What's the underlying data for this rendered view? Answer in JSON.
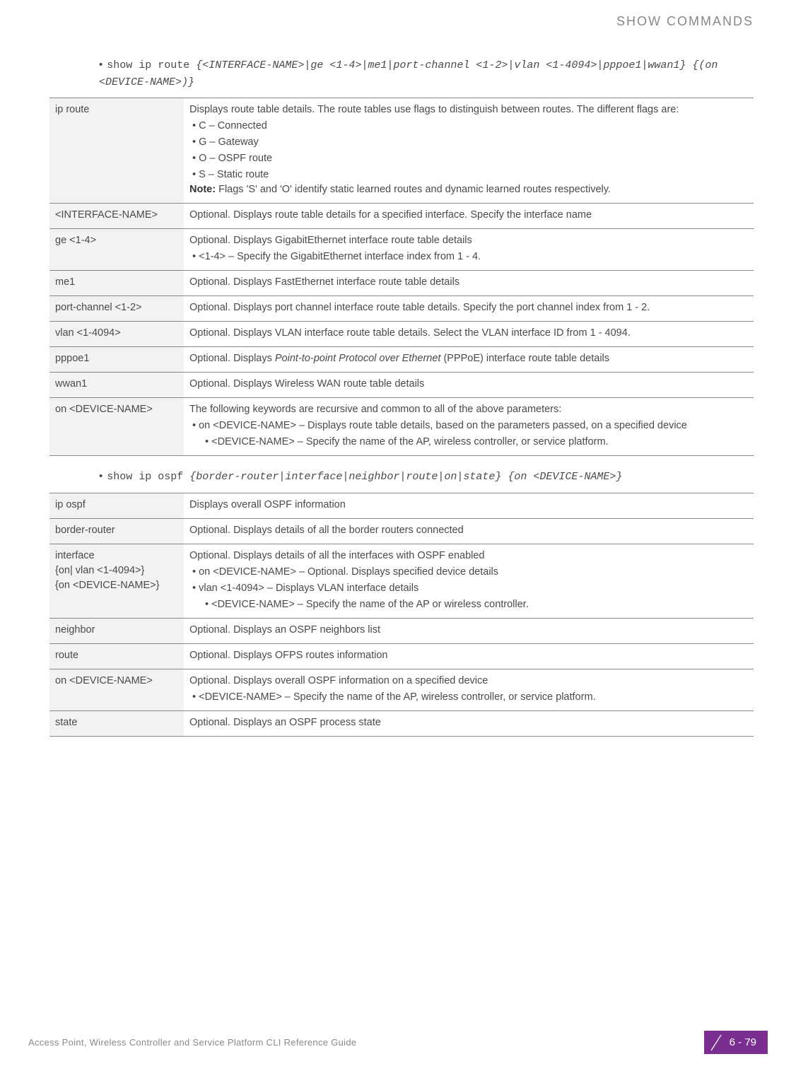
{
  "header": {
    "title": "SHOW COMMANDS"
  },
  "commands": [
    {
      "prefix": "show ip route ",
      "args": "{<INTERFACE-NAME>|ge <1-4>|me1|port-channel <1-2>|vlan <1-4094>|pppoe1|wwan1} {(on <DEVICE-NAME>)}"
    },
    {
      "prefix": "show ip ospf ",
      "args": "{border-router|interface|neighbor|route|on|state} {on <DEVICE-NAME>}"
    }
  ],
  "table1": {
    "r0": {
      "param": "ip route",
      "desc1": "Displays route table details. The route tables use flags to distinguish between routes. The different flags are:",
      "b1": "C – Connected",
      "b2": "G – Gateway",
      "b3": "O – OSPF route",
      "b4": "S – Static route",
      "noteLabel": "Note:",
      "note": " Flags 'S' and 'O' identify static learned routes and dynamic learned routes respectively."
    },
    "r1": {
      "param": "<INTERFACE-NAME>",
      "desc": "Optional. Displays route table details for a specified interface. Specify the interface name"
    },
    "r2": {
      "param": "ge <1-4>",
      "desc": "Optional. Displays GigabitEthernet interface route table details",
      "b1": "<1-4> – Specify the GigabitEthernet interface index from 1 - 4."
    },
    "r3": {
      "param": "me1",
      "desc": "Optional. Displays FastEthernet interface route table details"
    },
    "r4": {
      "param": "port-channel <1-2>",
      "desc": "Optional. Displays port channel interface route table details. Specify the port channel index from 1 - 2."
    },
    "r5": {
      "param": "vlan <1-4094>",
      "desc": "Optional. Displays VLAN interface route table details. Select the VLAN interface ID from 1 - 4094."
    },
    "r6": {
      "param": "pppoe1",
      "descPre": "Optional. Displays ",
      "descItal": "Point-to-point Protocol over Ethernet",
      "descPost": " (PPPoE) interface route table details"
    },
    "r7": {
      "param": "wwan1",
      "desc": "Optional. Displays Wireless WAN route table details"
    },
    "r8": {
      "param": "on <DEVICE-NAME>",
      "desc": "The following keywords are recursive and common to all of the above parameters:",
      "b1": "on <DEVICE-NAME> – Displays route table details, based on the parameters passed, on a specified device",
      "s1": "<DEVICE-NAME> – Specify the name of the AP, wireless controller, or service platform."
    }
  },
  "table2": {
    "r0": {
      "param": "ip ospf",
      "desc": "Displays overall OSPF information"
    },
    "r1": {
      "param": "border-router",
      "desc": "Optional. Displays details of all the border routers connected"
    },
    "r2": {
      "param1": "interface",
      "param2": "{on| vlan <1-4094>}",
      "param3": "{on <DEVICE-NAME>}",
      "desc": "Optional. Displays details of all the interfaces with OSPF enabled",
      "b1": "on <DEVICE-NAME> – Optional. Displays specified device details",
      "b2": "vlan <1-4094> – Displays VLAN interface details",
      "s1": "<DEVICE-NAME> – Specify the name of the AP or wireless controller."
    },
    "r3": {
      "param": "neighbor",
      "desc": "Optional. Displays an OSPF neighbors list"
    },
    "r4": {
      "param": "route",
      "desc": "Optional. Displays OFPS routes information"
    },
    "r5": {
      "param": "on <DEVICE-NAME>",
      "desc": "Optional. Displays overall OSPF information on a specified device",
      "b1": "<DEVICE-NAME> – Specify the name of the AP, wireless controller, or service platform."
    },
    "r6": {
      "param": "state",
      "desc": "Optional. Displays an OSPF process state"
    }
  },
  "footer": {
    "text": "Access Point, Wireless Controller and Service Platform CLI Reference Guide",
    "page": "6 - 79"
  }
}
